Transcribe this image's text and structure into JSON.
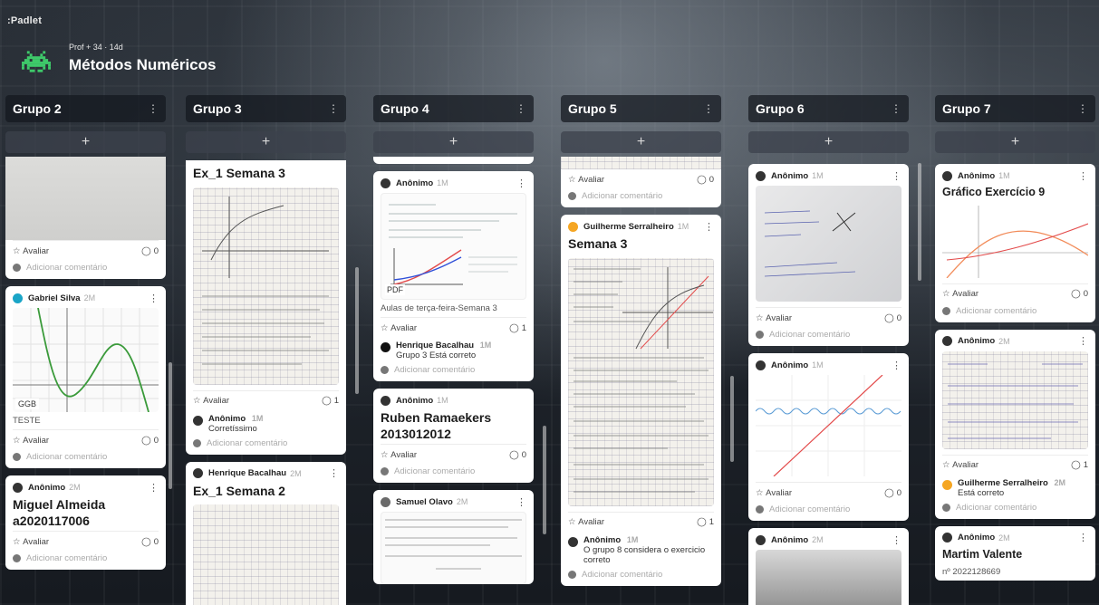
{
  "app": {
    "logo": ":Padlet"
  },
  "board": {
    "meta": "Prof + 34 · 14d",
    "title": "Métodos Numéricos"
  },
  "ui": {
    "add_symbol": "+",
    "menu_symbol": "⋮",
    "rate_label": "Avaliar",
    "add_comment": "Adicionar comentário",
    "pdf_badge": "PDF",
    "ggb_badge": "GGB"
  },
  "columns": [
    {
      "title": "Grupo 2"
    },
    {
      "title": "Grupo 3"
    },
    {
      "title": "Grupo 4"
    },
    {
      "title": "Grupo 5"
    },
    {
      "title": "Grupo 6"
    },
    {
      "title": "Grupo 7"
    }
  ],
  "col1": {
    "c1": {
      "count": "0"
    },
    "c2": {
      "author": "Gabriel Silva",
      "ago": "2M",
      "caption": "TESTE",
      "count": "0"
    },
    "c3": {
      "author": "Anônimo",
      "ago": "2M",
      "title": "Miguel Almeida a2020117006",
      "count": "0"
    }
  },
  "col2": {
    "c1": {
      "title": "Ex_1 Semana 3",
      "count": "1",
      "reply_author": "Anônimo",
      "reply_ago": "1M",
      "reply_text": "Corretíssimo"
    },
    "c2": {
      "author": "Henrique Bacalhau",
      "ago": "2M",
      "title": "Ex_1 Semana 2"
    }
  },
  "col3": {
    "c1": {
      "author": "Anônimo",
      "ago": "1M",
      "caption": "Aulas de terça-feira-Semana 3",
      "count": "1",
      "reply_author": "Henrique Bacalhau",
      "reply_ago": "1M",
      "reply_text": "Grupo 3 Está correto"
    },
    "c2": {
      "author": "Anônimo",
      "ago": "1M",
      "title": "Ruben Ramaekers 2013012012",
      "count": "0"
    },
    "c3": {
      "author": "Samuel Olavo",
      "ago": "2M"
    }
  },
  "col4": {
    "c1": {
      "count": "0"
    },
    "c2": {
      "author": "Guilherme Serralheiro",
      "ago": "1M",
      "title": "Semana 3",
      "count": "1",
      "reply_author": "Anônimo",
      "reply_ago": "1M",
      "reply_text": "O grupo 8 considera o exercicio correto"
    }
  },
  "col5": {
    "c1": {
      "author": "Anônimo",
      "ago": "1M",
      "count": "0"
    },
    "c2": {
      "author": "Anônimo",
      "ago": "1M",
      "count": "0"
    },
    "c3": {
      "author": "Anônimo",
      "ago": "2M"
    }
  },
  "col6": {
    "c1": {
      "author": "Anônimo",
      "ago": "1M",
      "title": "Gráfico Exercício 9",
      "count": "0"
    },
    "c2": {
      "author": "Anônimo",
      "ago": "2M",
      "count": "1",
      "reply_author": "Guilherme Serralheiro",
      "reply_ago": "2M",
      "reply_text": "Está correto"
    },
    "c3": {
      "author": "Anônimo",
      "ago": "2M",
      "title": "Martim Valente",
      "text": "nº 2022128669"
    }
  },
  "colors": {
    "accent_orange": "#f5a623",
    "accent_teal": "#1aa5c7",
    "graph_green": "#3a9a3a",
    "graph_red": "#e34b4b",
    "graph_blue": "#2f4fd8"
  }
}
